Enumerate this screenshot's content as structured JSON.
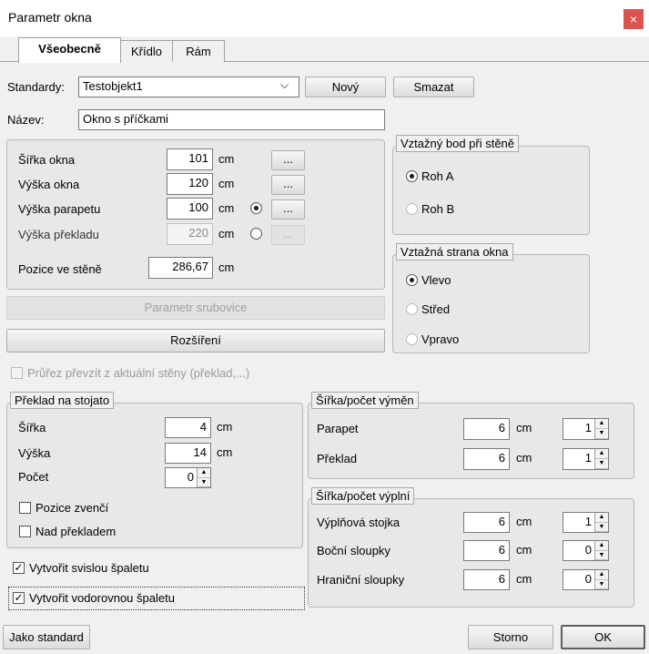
{
  "window": {
    "title": "Parametr okna",
    "close_glyph": "×"
  },
  "tabs": [
    {
      "label": "Všeobecně"
    },
    {
      "label": "Křídlo"
    },
    {
      "label": "Rám"
    }
  ],
  "standards": {
    "label": "Standardy:",
    "value": "Testobjekt1",
    "new_button": "Nový",
    "delete_button": "Smazat"
  },
  "name": {
    "label": "Název:",
    "value": "Okno s příčkami"
  },
  "dims": {
    "width": {
      "label": "Šířka okna",
      "value": "101",
      "unit": "cm"
    },
    "height": {
      "label": "Výška okna",
      "value": "120",
      "unit": "cm"
    },
    "parapet": {
      "label": "Výška parapetu",
      "value": "100",
      "unit": "cm"
    },
    "lintel": {
      "label": "Výška překladu",
      "value": "220",
      "unit": "cm"
    },
    "position": {
      "label": "Pozice ve stěně",
      "value": "286,67",
      "unit": "cm"
    },
    "ellipsis": "..."
  },
  "buttons": {
    "param": "Parametr srubovice",
    "expand": "Rozšíření",
    "as_standard": "Jako standard",
    "cancel": "Storno",
    "ok": "OK"
  },
  "ref_point": {
    "title": "Vztažný bod při stěně",
    "options": [
      "Roh A",
      "Roh B"
    ]
  },
  "ref_side": {
    "title": "Vztažná strana okna",
    "options": [
      "Vlevo",
      "Střed",
      "Vpravo"
    ]
  },
  "take_over": {
    "label": "Průřez převzít z aktuální stěny (překlad,...)"
  },
  "lintel_box": {
    "title": "Překlad na stojato",
    "width": {
      "label": "Šířka",
      "value": "4",
      "unit": "cm"
    },
    "height": {
      "label": "Výška",
      "value": "14",
      "unit": "cm"
    },
    "count": {
      "label": "Počet",
      "value": "0"
    },
    "outside": "Pozice zvenčí",
    "above": "Nad překladem"
  },
  "reveal": {
    "vertical": "Vytvořit svislou špaletu",
    "horizontal": "Vytvořit vodorovnou špaletu"
  },
  "exchange": {
    "title": "Šířka/počet výměn",
    "rows": [
      {
        "label": "Parapet",
        "value": "6",
        "unit": "cm",
        "count": "1"
      },
      {
        "label": "Překlad",
        "value": "6",
        "unit": "cm",
        "count": "1"
      }
    ]
  },
  "fill": {
    "title": "Šířka/počet výplní",
    "rows": [
      {
        "label": "Výplňová stojka",
        "value": "6",
        "unit": "cm",
        "count": "1"
      },
      {
        "label": "Boční sloupky",
        "value": "6",
        "unit": "cm",
        "count": "0"
      },
      {
        "label": "Hraniční sloupky",
        "value": "6",
        "unit": "cm",
        "count": "0"
      }
    ]
  },
  "glyphs": {
    "check": "✓",
    "arrow_up": "▲",
    "arrow_down": "▼",
    "chevron_down": "⌵"
  }
}
